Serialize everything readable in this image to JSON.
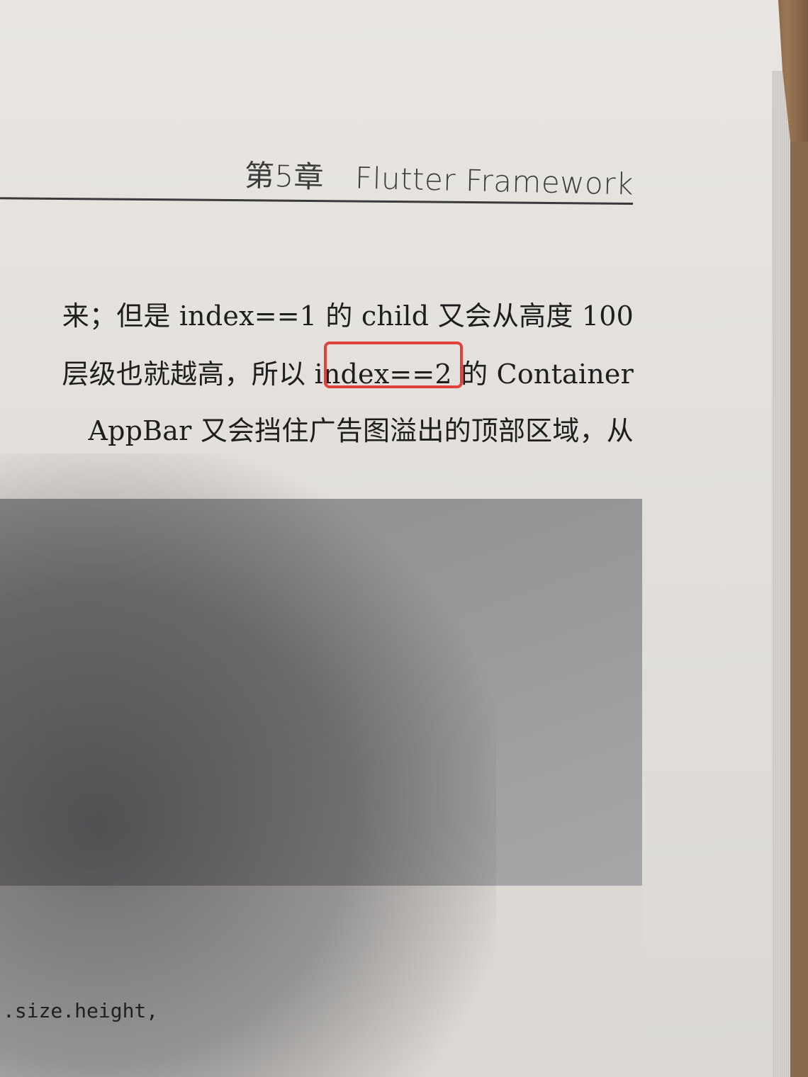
{
  "header": {
    "chapter": "第5章",
    "title": "Flutter Framework"
  },
  "body_lines": [
    "来；但是 index==1 的 child 又会从高度 100",
    "层级也就越高，所以 ",
    "AppBar 又会挡住广告图溢出的顶部区域，从"
  ],
  "highlight": {
    "text": "index==2",
    "after": " 的 Container",
    "color": "#e0413a"
  },
  "code_fragment": ".size.height,"
}
